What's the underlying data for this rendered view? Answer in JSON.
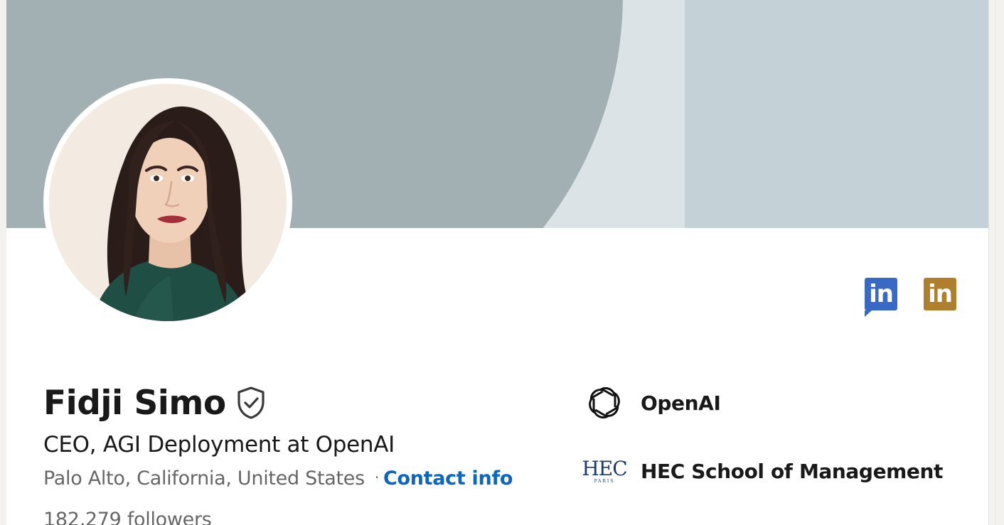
{
  "profile": {
    "name": "Fidji Simo",
    "headline": "CEO, AGI Deployment at OpenAI",
    "location": "Palo Alto, California, United States",
    "separator": "·",
    "contact_info_label": "Contact info",
    "followers": "182,279 followers",
    "verified_icon": "verified-shield-icon"
  },
  "badges": [
    {
      "text": "in",
      "icon": "linkedin-icon",
      "color": "#3969c6"
    },
    {
      "text": "in",
      "icon": "linkedin-premium-icon",
      "color": "#b07f2d"
    }
  ],
  "organizations": [
    {
      "name": "OpenAI",
      "icon": "openai-logo-icon"
    },
    {
      "name": "HEC School of Management",
      "icon": "hec-paris-logo-icon",
      "logo_text": "HEC",
      "logo_subtext": "PARIS"
    }
  ],
  "colors": {
    "banner_light": "#dce3e6",
    "banner_arc": "#a2b0b4",
    "banner_panel": "#c4d2d7",
    "link": "#0a66c2"
  }
}
